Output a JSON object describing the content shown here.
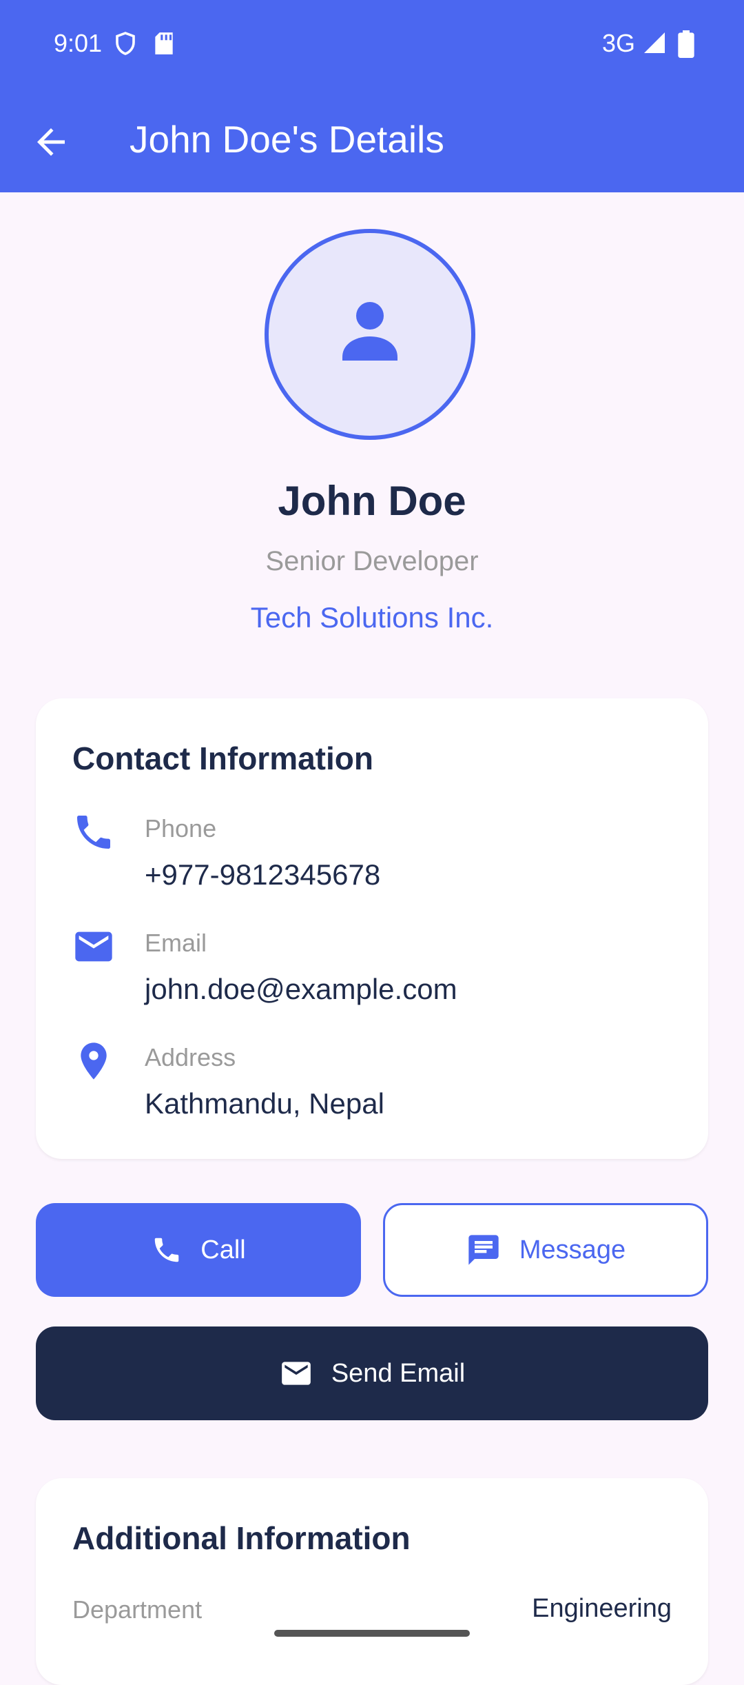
{
  "status_bar": {
    "time": "9:01",
    "network": "3G"
  },
  "app_bar": {
    "title": "John Doe's Details"
  },
  "profile": {
    "name": "John Doe",
    "role": "Senior Developer",
    "company": "Tech Solutions Inc."
  },
  "contact": {
    "title": "Contact Information",
    "rows": [
      {
        "label": "Phone",
        "value": "+977-9812345678",
        "icon": "phone-icon"
      },
      {
        "label": "Email",
        "value": "john.doe@example.com",
        "icon": "email-icon"
      },
      {
        "label": "Address",
        "value": "Kathmandu, Nepal",
        "icon": "location-pin-icon"
      }
    ]
  },
  "actions": {
    "call_label": "Call",
    "message_label": "Message",
    "email_label": "Send Email"
  },
  "additional": {
    "title": "Additional Information",
    "rows": [
      {
        "label": "Department",
        "value": "Engineering"
      }
    ]
  },
  "colors": {
    "primary": "#4B67F0",
    "dark": "#1E2A4A",
    "background": "#FCF5FD",
    "muted": "#9A9A9A"
  }
}
